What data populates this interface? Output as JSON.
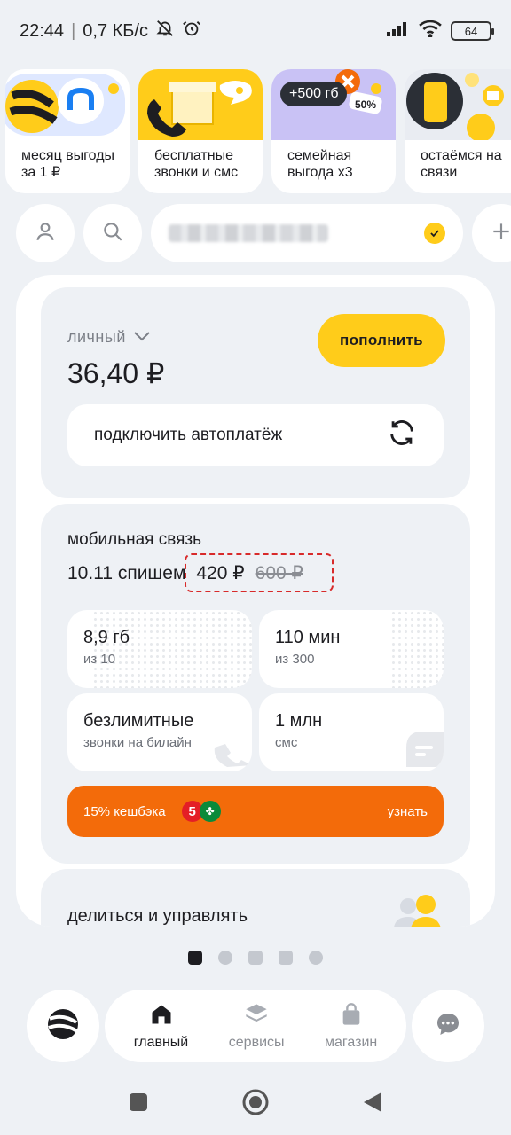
{
  "status_bar": {
    "time": "22:44",
    "speed": "0,7 КБ/с",
    "battery": "64",
    "icons": [
      "bell-off-icon",
      "alarm-icon",
      "signal-icon",
      "wifi-icon",
      "battery-icon"
    ]
  },
  "stories": [
    {
      "text": "месяц выгоды за 1 ₽",
      "icon": "bee-logo-icon"
    },
    {
      "text": "бесплатные звонки и смс",
      "icon": "gift-phone-icon"
    },
    {
      "text": "семейная выгода х3",
      "badge": "+500 гб",
      "sale": "50%"
    },
    {
      "text": "остаёмся на связи",
      "icon": "phone-icon"
    }
  ],
  "top_row": {
    "profile_icon": "user-icon",
    "search_icon": "search-icon",
    "add_icon": "plus-icon"
  },
  "balance_card": {
    "label": "личный",
    "balance": "36,40 ₽",
    "topup_label": "пополнить",
    "autopay_label": "подключить автоплатёж"
  },
  "mobile_card": {
    "title": "мобильная связь",
    "charge_prefix": "10.11 спишем",
    "price_new": "420 ₽",
    "price_old": "600 ₽",
    "tiles": [
      {
        "big": "8,9 гб",
        "small": "из 10"
      },
      {
        "big": "110 мин",
        "small": "из 300"
      },
      {
        "big": "безлимитные",
        "small": "звонки на билайн"
      },
      {
        "big": "1 млн",
        "small": "смс"
      }
    ],
    "cashback_label": "15% кешбэка",
    "cashback_action": "узнать",
    "cashback_logo": "5"
  },
  "share_card": {
    "title": "делиться и управлять"
  },
  "bottom_nav": {
    "items": [
      {
        "label": "главный",
        "icon": "home-icon"
      },
      {
        "label": "сервисы",
        "icon": "layers-icon"
      },
      {
        "label": "магазин",
        "icon": "bag-icon"
      }
    ]
  },
  "colors": {
    "accent_yellow": "#ffcc1a",
    "cashback_orange": "#f36b0a",
    "background": "#eef1f5"
  }
}
